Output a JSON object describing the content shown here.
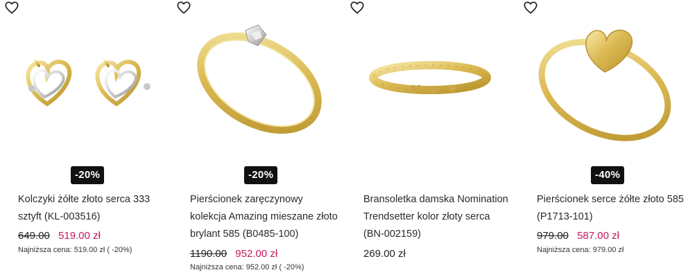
{
  "products": [
    {
      "name": "Kolczyki żółte złoto serca 333 sztyft (KL-003516)",
      "badge": "-20%",
      "old_price": "649.00",
      "price": "519.00 zł",
      "lowest_price": "Najniższa cena: 519.00 zł ( -20%)",
      "favorite_icon": "heart-outline-icon"
    },
    {
      "name": "Pierścionek zaręczynowy kolekcja Amazing mieszane złoto brylant 585 (B0485-100)",
      "badge": "-20%",
      "old_price": "1190.00",
      "price": "952.00 zł",
      "lowest_price": "Najniższa cena: 952.00 zł ( -20%)",
      "favorite_icon": "heart-outline-icon"
    },
    {
      "name": "Bransoletka damska Nomination Trendsetter kolor złoty serca (BN-002159)",
      "price": "269.00 zł",
      "favorite_icon": "heart-outline-icon"
    },
    {
      "name": "Pierścionek serce żółte złoto 585 (P1713-101)",
      "badge": "-40%",
      "old_price": "979.00",
      "price": "587.00 zł",
      "lowest_price": "Najniższa cena: 979.00 zł",
      "favorite_icon": "heart-outline-icon"
    }
  ],
  "colors": {
    "sale_price": "#c2185b",
    "badge_bg": "#111111",
    "gold": "#e2c46a"
  }
}
